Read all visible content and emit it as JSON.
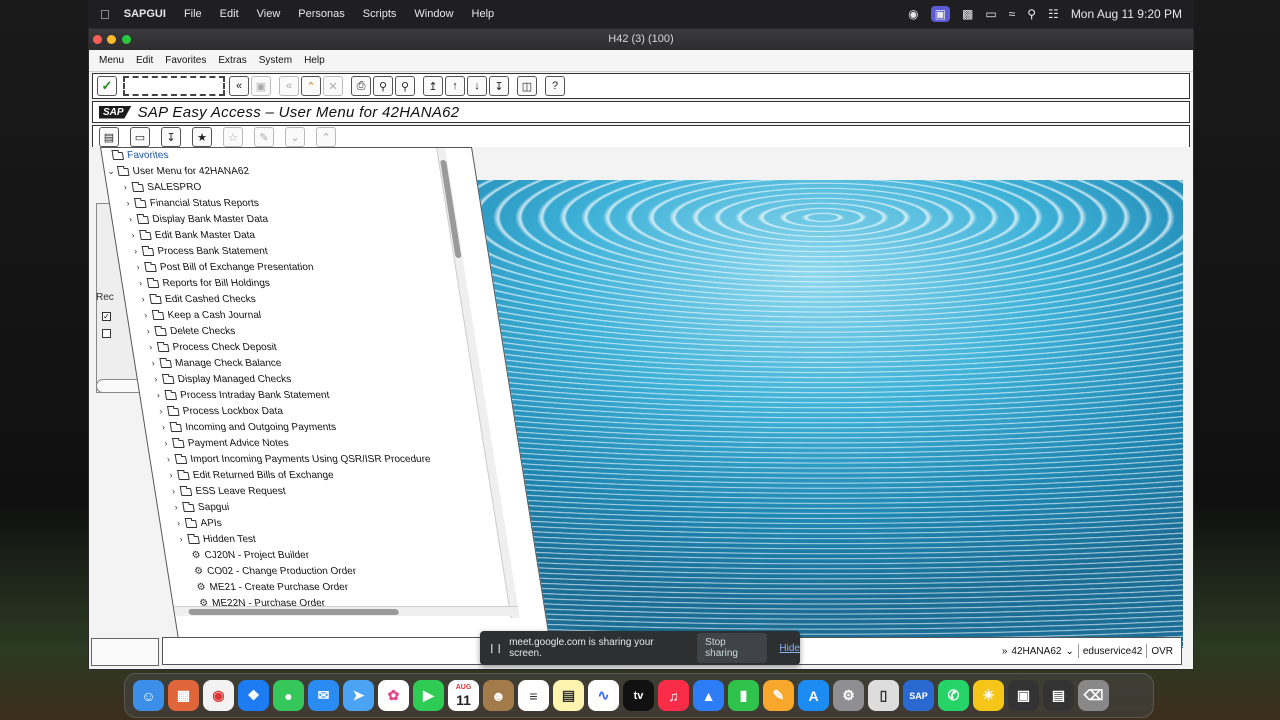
{
  "mac_menubar": {
    "app": "SAPGUI",
    "items": [
      "File",
      "Edit",
      "View",
      "Personas",
      "Scripts",
      "Window",
      "Help"
    ],
    "clock": "Mon Aug 11  9:20 PM"
  },
  "window": {
    "title": "H42 (3) (100)"
  },
  "sap_menu": [
    "Menu",
    "Edit",
    "Favorites",
    "Extras",
    "System",
    "Help"
  ],
  "command_field": {
    "value": ""
  },
  "title_area": {
    "logo": "SAP",
    "title": "SAP Easy Access  –  User Menu for 42HANA62"
  },
  "background_panel": {
    "label": "Rec"
  },
  "tree": {
    "favorites": "Favorites",
    "root": "User Menu for 42HANA62",
    "folders": [
      "SALESPRO",
      "Financial Status Reports",
      "Display Bank Master Data",
      "Edit Bank Master Data",
      "Process Bank Statement",
      "Post Bill of Exchange Presentation",
      "Reports for Bill Holdings",
      "Edit Cashed Checks",
      "Keep a Cash Journal",
      "Delete Checks",
      "Process Check Deposit",
      "Manage Check Balance",
      "Display Managed Checks",
      "Process Intraday Bank Statement",
      "Process Lockbox Data",
      "Incoming and Outgoing Payments",
      "Payment Advice Notes",
      "Import Incoming Payments Using QSR/ISR Procedure",
      "Edit Returned Bills of Exchange",
      "ESS Leave Request",
      "Sapgui",
      "APIs",
      "Hidden Test"
    ],
    "transactions": [
      "CJ20N - Project Builder",
      "CO02 - Change Production Order",
      "ME21 - Create Purchase Order",
      "ME22N - Purchase Order"
    ]
  },
  "status_bar": {
    "system": "42HANA62",
    "server": "eduservice42",
    "mode": "OVR"
  },
  "share_banner": {
    "text": "meet.google.com is sharing your screen.",
    "stop": "Stop sharing",
    "hide": "Hide"
  },
  "dock": {
    "calendar_month": "AUG",
    "calendar_day": "11",
    "tv_label": "tv",
    "sap_label": "SAP"
  }
}
